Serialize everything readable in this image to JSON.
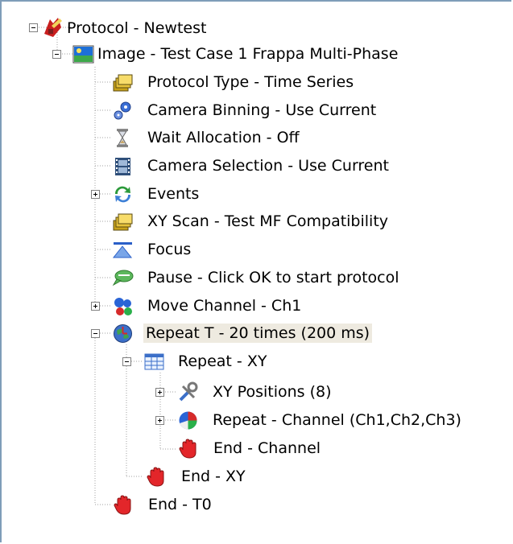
{
  "tree": {
    "root": {
      "label": "Protocol - Newtest",
      "icon": "protocol-icon",
      "expanded": true
    },
    "image": {
      "label": "Image - Test Case 1 Frappa Multi-Phase",
      "icon": "image-icon",
      "expanded": true
    },
    "items": [
      {
        "label": "Protocol Type - Time Series",
        "icon": "folders-icon"
      },
      {
        "label": "Camera Binning - Use Current",
        "icon": "gears-icon"
      },
      {
        "label": "Wait Allocation - Off",
        "icon": "hourglass-icon"
      },
      {
        "label": "Camera Selection - Use Current",
        "icon": "film-strip-icon"
      },
      {
        "label": "Events",
        "icon": "refresh-arrows-icon",
        "expanded": false
      },
      {
        "label": "XY Scan - Test MF Compatibility",
        "icon": "folders-icon"
      },
      {
        "label": "Focus",
        "icon": "focus-icon"
      },
      {
        "label": "Pause - Click OK to start protocol",
        "icon": "speech-bubble-icon"
      },
      {
        "label": "Move Channel - Ch1",
        "icon": "channel-dots-icon",
        "expanded": false
      },
      {
        "label": "Repeat T - 20 times (200 ms)",
        "icon": "clock-globe-icon",
        "expanded": true,
        "selected": true
      }
    ],
    "repeat_xy": {
      "label": "Repeat - XY",
      "icon": "grid-icon",
      "expanded": true
    },
    "xy_positions": {
      "label": "XY Positions (8)",
      "icon": "tools-icon",
      "expanded": false
    },
    "repeat_channel": {
      "label": "Repeat - Channel (Ch1,Ch2,Ch3)",
      "icon": "pie-chart-icon",
      "expanded": false
    },
    "end_channel": {
      "label": "End - Channel",
      "icon": "red-hand-icon"
    },
    "end_xy": {
      "label": "End - XY",
      "icon": "red-hand-icon"
    },
    "end_t": {
      "label": "End - T0",
      "icon": "red-hand-icon"
    }
  },
  "colors": {
    "border": "#7f9db9",
    "selection": "#eeeae0",
    "tree_line": "#a0a0a0",
    "stop_red": "#e3262a"
  }
}
